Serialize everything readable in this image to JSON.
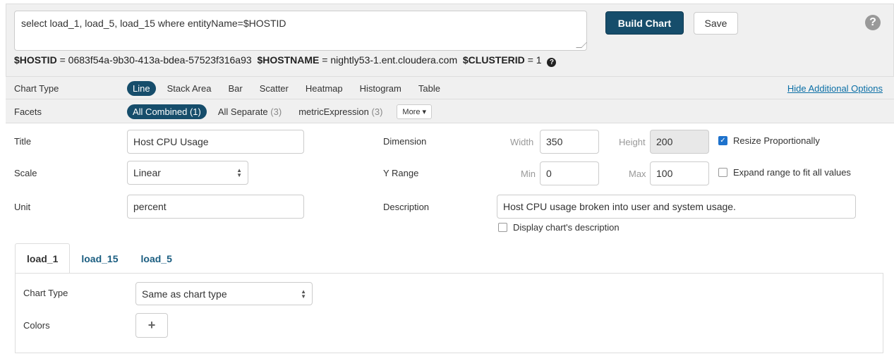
{
  "query": {
    "text": "select load_1, load_5, load_15 where entityName=$HOSTID",
    "build_label": "Build Chart",
    "save_label": "Save",
    "help_glyph": "?"
  },
  "vars": {
    "hostid_name": "$HOSTID",
    "hostid_value": "0683f54a-9b30-413a-bdea-57523f316a93",
    "hostname_name": "$HOSTNAME",
    "hostname_value": "nightly53-1.ent.cloudera.com",
    "clusterid_name": "$CLUSTERID",
    "clusterid_value": "1",
    "equals": "="
  },
  "chart_type": {
    "label": "Chart Type",
    "options": [
      "Line",
      "Stack Area",
      "Bar",
      "Scatter",
      "Heatmap",
      "Histogram",
      "Table"
    ],
    "active_index": 0,
    "hide_link": "Hide Additional Options"
  },
  "facets": {
    "label": "Facets",
    "options": [
      {
        "name": "All Combined",
        "count": "(1)"
      },
      {
        "name": "All Separate",
        "count": "(3)"
      },
      {
        "name": "metricExpression",
        "count": "(3)"
      }
    ],
    "active_index": 0,
    "more_label": "More"
  },
  "form": {
    "title_label": "Title",
    "title_value": "Host CPU Usage",
    "scale_label": "Scale",
    "scale_value": "Linear",
    "unit_label": "Unit",
    "unit_value": "percent",
    "dimension_label": "Dimension",
    "width_label": "Width",
    "width_value": "350",
    "height_label": "Height",
    "height_value": "200",
    "resize_label": "Resize Proportionally",
    "resize_checked": true,
    "yrange_label": "Y Range",
    "min_label": "Min",
    "min_value": "0",
    "max_label": "Max",
    "max_value": "100",
    "expand_label": "Expand range to fit all values",
    "expand_checked": false,
    "description_label": "Description",
    "description_value": "Host CPU usage broken into user and system usage.",
    "display_desc_label": "Display chart's description",
    "display_desc_checked": false
  },
  "series_tabs": {
    "tabs": [
      "load_1",
      "load_15",
      "load_5"
    ],
    "active_index": 0,
    "chart_type_label": "Chart Type",
    "chart_type_value": "Same as chart type",
    "colors_label": "Colors",
    "add_color_glyph": "+"
  },
  "colors": {
    "accent": "#164d6b",
    "link": "#0b6fa6",
    "checkbox": "#1e72cc"
  }
}
